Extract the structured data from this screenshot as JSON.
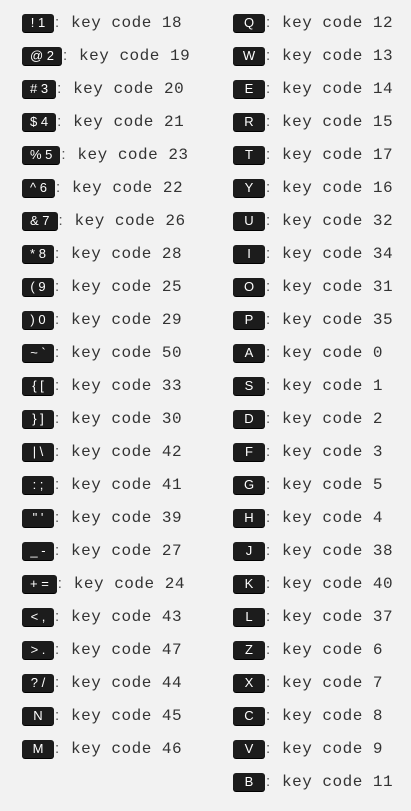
{
  "colors": {
    "background": "#f2f2f2",
    "keycap": "#1c1c1c",
    "keycap_text": "#ffffff"
  },
  "left": [
    {
      "key": "! 1",
      "desc": "key code 18"
    },
    {
      "key": "@ 2",
      "desc": "key code 19"
    },
    {
      "key": "# 3",
      "desc": "key code 20"
    },
    {
      "key": "$ 4",
      "desc": "key code 21"
    },
    {
      "key": "% 5",
      "desc": "key code 23"
    },
    {
      "key": "^ 6",
      "desc": "key code 22"
    },
    {
      "key": "& 7",
      "desc": "key code 26"
    },
    {
      "key": "* 8",
      "desc": "key code 28"
    },
    {
      "key": "( 9",
      "desc": "key code 25"
    },
    {
      "key": ") 0",
      "desc": "key code 29"
    },
    {
      "key": "~ `",
      "desc": "key code 50"
    },
    {
      "key": "{ [",
      "desc": "key code 33"
    },
    {
      "key": "} ]",
      "desc": "key code 30"
    },
    {
      "key": "| \\",
      "desc": "key code 42"
    },
    {
      "key": ": ;",
      "desc": "key code 41"
    },
    {
      "key": "\" '",
      "desc": "key code 39"
    },
    {
      "key": "_ -",
      "desc": "key code 27"
    },
    {
      "key": "+ =",
      "desc": "key code 24"
    },
    {
      "key": "< ,",
      "desc": "key code 43"
    },
    {
      "key": "> .",
      "desc": "key code 47"
    },
    {
      "key": "? /",
      "desc": "key code 44"
    },
    {
      "key": "N",
      "desc": "key code 45"
    },
    {
      "key": "M",
      "desc": "key code 46"
    }
  ],
  "right": [
    {
      "key": "Q",
      "desc": "key code 12"
    },
    {
      "key": "W",
      "desc": "key code 13"
    },
    {
      "key": "E",
      "desc": "key code 14"
    },
    {
      "key": "R",
      "desc": "key code 15"
    },
    {
      "key": "T",
      "desc": "key code 17"
    },
    {
      "key": "Y",
      "desc": "key code 16"
    },
    {
      "key": "U",
      "desc": "key code 32"
    },
    {
      "key": "I",
      "desc": "key code 34"
    },
    {
      "key": "O",
      "desc": "key code 31"
    },
    {
      "key": "P",
      "desc": "key code 35"
    },
    {
      "key": "A",
      "desc": "key code 0"
    },
    {
      "key": "S",
      "desc": "key code 1"
    },
    {
      "key": "D",
      "desc": "key code 2"
    },
    {
      "key": "F",
      "desc": "key code 3"
    },
    {
      "key": "G",
      "desc": "key code 5"
    },
    {
      "key": "H",
      "desc": "key code 4"
    },
    {
      "key": "J",
      "desc": "key code 38"
    },
    {
      "key": "K",
      "desc": "key code 40"
    },
    {
      "key": "L",
      "desc": "key code 37"
    },
    {
      "key": "Z",
      "desc": "key code 6"
    },
    {
      "key": "X",
      "desc": "key code 7"
    },
    {
      "key": "C",
      "desc": "key code 8"
    },
    {
      "key": "V",
      "desc": "key code 9"
    },
    {
      "key": "B",
      "desc": "key code 11"
    }
  ]
}
